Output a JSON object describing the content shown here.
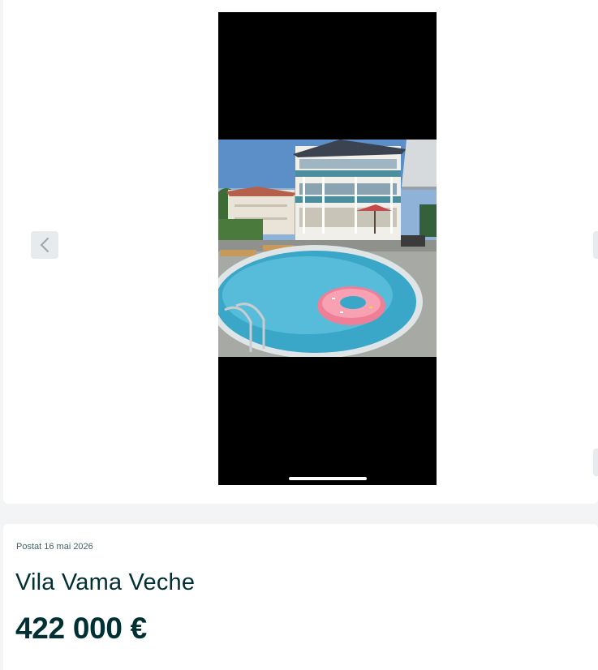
{
  "gallery": {
    "photo_alt": "Vila Vama Veche",
    "prev_icon": "chevron-left-icon",
    "next_icon": "chevron-right-icon"
  },
  "listing": {
    "posted": "Postat 16 mai 2026",
    "title": "Vila Vama Veche",
    "price": "422 000 €"
  },
  "colors": {
    "page_background": "#f2f4f5",
    "card_background": "#ffffff",
    "text_primary": "#002f34",
    "text_secondary": "#406367",
    "nav_button": "#e7ebed"
  }
}
